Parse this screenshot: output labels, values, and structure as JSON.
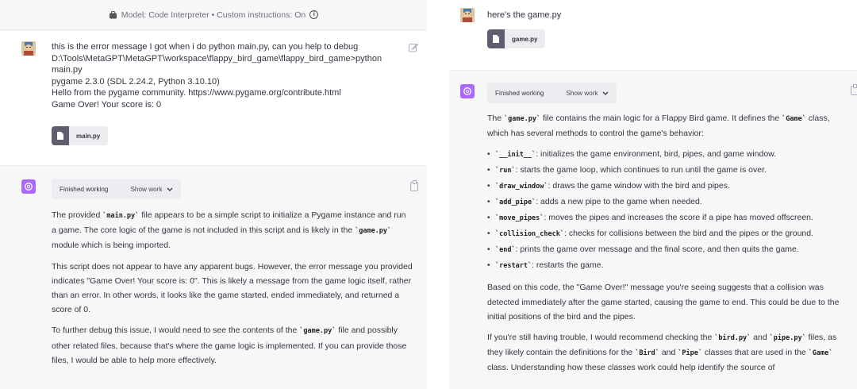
{
  "left": {
    "model_bar": {
      "text": "Model: Code Interpreter • Custom instructions: On"
    },
    "user": {
      "lines": [
        "this is the error message I got when i do python main.py, can you help to debug",
        "D:\\Tools\\MetaGPT\\MetaGPT\\workspace\\flappy_bird_game\\flappy_bird_game>python",
        "main.py",
        "pygame 2.3.0 (SDL 2.24.2, Python 3.10.10)",
        "Hello from the pygame community. https://www.pygame.org/contribute.html",
        "Game Over! Your score is:  0"
      ],
      "file": "main.py"
    },
    "assistant": {
      "finished": "Finished working",
      "show_work": "Show work",
      "p1": {
        "t1": "The provided ",
        "c1": "`main.py`",
        "t2": " file appears to be a simple script to initialize a Pygame instance and run a game. The core logic of the game is not included in this script and is likely in the ",
        "c2": "`game.py`",
        "t3": " module which is being imported."
      },
      "p2": "This script does not appear to have any apparent bugs. However, the error message you provided indicates \"Game Over! Your score is: 0\". This is likely a message from the game logic itself, rather than an error. In other words, it looks like the game started, ended immediately, and returned a score of 0.",
      "p3": {
        "t1": "To further debug this issue, I would need to see the contents of the ",
        "c1": "`game.py`",
        "t2": " file and possibly other related files, because that's where the game logic is implemented. If you can provide those files, I would be able to help more effectively."
      }
    }
  },
  "right": {
    "user": {
      "text": "here's the game.py",
      "file": "game.py"
    },
    "assistant": {
      "finished": "Finished working",
      "show_work": "Show work",
      "intro": {
        "t1": "The ",
        "c1": "`game.py`",
        "t2": " file contains the main logic for a Flappy Bird game. It defines the ",
        "c2": "`Game`",
        "t3": " class, which has several methods to control the game's behavior:"
      },
      "methods": [
        {
          "code": "`__init__`",
          "desc": ": initializes the game environment, bird, pipes, and game window."
        },
        {
          "code": "`run`",
          "desc": ": starts the game loop, which continues to run until the game is over."
        },
        {
          "code": "`draw_window`",
          "desc": ": draws the game window with the bird and pipes."
        },
        {
          "code": "`add_pipe`",
          "desc": ": adds a new pipe to the game when needed."
        },
        {
          "code": "`move_pipes`",
          "desc": ": moves the pipes and increases the score if a pipe has moved offscreen."
        },
        {
          "code": "`collision_check`",
          "desc": ": checks for collisions between the bird and the pipes or the ground."
        },
        {
          "code": "`end`",
          "desc": ": prints the game over message and the final score, and then quits the game."
        },
        {
          "code": "`restart`",
          "desc": ": restarts the game."
        }
      ],
      "p2": "Based on this code, the \"Game Over!\" message you're seeing suggests that a collision was detected immediately after the game started, causing the game to end. This could be due to the initial positions of the bird and the pipes.",
      "p3": {
        "t1": "If you're still having trouble, I would recommend checking the ",
        "c1": "`bird.py`",
        "t2": " and ",
        "c2": "`pipe.py`",
        "t3": " files, as they likely contain the definitions for the ",
        "c3": "`Bird`",
        "t4": " and ",
        "c4": "`Pipe`",
        "t5": " classes that are used in the ",
        "c5": "`Game`",
        "t6": " class. Understanding how these classes work could help identify the source of"
      }
    }
  },
  "colors": {
    "gpt_avatar": "#ab68ff",
    "assistant_bg": "#f7f7f8",
    "pill_bg": "#ececf1"
  }
}
